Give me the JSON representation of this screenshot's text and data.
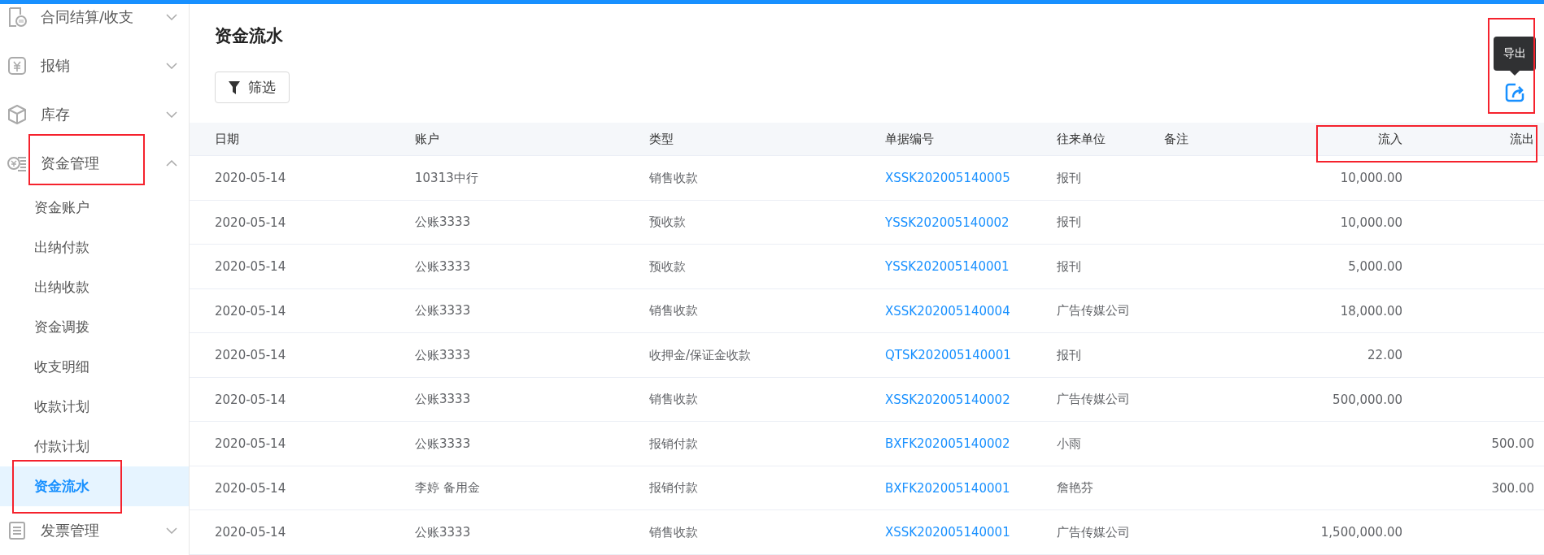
{
  "sidebar": {
    "items": [
      {
        "label": "合同结算/收支",
        "expanded": false
      },
      {
        "label": "报销",
        "expanded": false
      },
      {
        "label": "库存",
        "expanded": false
      },
      {
        "label": "资金管理",
        "expanded": true,
        "children": [
          {
            "label": "资金账户",
            "selected": false
          },
          {
            "label": "出纳付款",
            "selected": false
          },
          {
            "label": "出纳收款",
            "selected": false
          },
          {
            "label": "资金调拨",
            "selected": false
          },
          {
            "label": "收支明细",
            "selected": false
          },
          {
            "label": "收款计划",
            "selected": false
          },
          {
            "label": "付款计划",
            "selected": false
          },
          {
            "label": "资金流水",
            "selected": true
          }
        ]
      },
      {
        "label": "发票管理",
        "expanded": false
      }
    ]
  },
  "page": {
    "title": "资金流水",
    "filter_button": "筛选",
    "export_tooltip": "导出"
  },
  "table": {
    "columns": [
      {
        "label": "日期",
        "kind": "text"
      },
      {
        "label": "账户",
        "kind": "text"
      },
      {
        "label": "类型",
        "kind": "text"
      },
      {
        "label": "单据编号",
        "kind": "text"
      },
      {
        "label": "往来单位",
        "kind": "text"
      },
      {
        "label": "备注",
        "kind": "text"
      },
      {
        "label": "流入",
        "kind": "amount"
      },
      {
        "label": "流出",
        "kind": "amount"
      }
    ],
    "rows": [
      {
        "date": "2020-05-14",
        "account": "10313中行",
        "type": "销售收款",
        "doc_no": "XSSK202005140005",
        "partner": "报刊",
        "inflow": "10,000.00"
      },
      {
        "date": "2020-05-14",
        "account": "公账3333",
        "type": "预收款",
        "doc_no": "YSSK202005140002",
        "partner": "报刊",
        "inflow": "10,000.00"
      },
      {
        "date": "2020-05-14",
        "account": "公账3333",
        "type": "预收款",
        "doc_no": "YSSK202005140001",
        "partner": "报刊",
        "inflow": "5,000.00"
      },
      {
        "date": "2020-05-14",
        "account": "公账3333",
        "type": "销售收款",
        "doc_no": "XSSK202005140004",
        "partner": "广告传媒公司",
        "inflow": "18,000.00"
      },
      {
        "date": "2020-05-14",
        "account": "公账3333",
        "type": "收押金/保证金收款",
        "doc_no": "QTSK202005140001",
        "partner": "报刊",
        "inflow": "22.00"
      },
      {
        "date": "2020-05-14",
        "account": "公账3333",
        "type": "销售收款",
        "doc_no": "XSSK202005140002",
        "partner": "广告传媒公司",
        "inflow": "500,000.00"
      },
      {
        "date": "2020-05-14",
        "account": "公账3333",
        "type": "报销付款",
        "doc_no": "BXFK202005140002",
        "partner": "小雨",
        "outflow": "500.00"
      },
      {
        "date": "2020-05-14",
        "account": "李婷 备用金",
        "type": "报销付款",
        "doc_no": "BXFK202005140001",
        "partner": "詹艳芬",
        "outflow": "300.00"
      },
      {
        "date": "2020-05-14",
        "account": "公账3333",
        "type": "销售收款",
        "doc_no": "XSSK202005140001",
        "partner": "广告传媒公司",
        "inflow": "1,500,000.00"
      }
    ]
  }
}
